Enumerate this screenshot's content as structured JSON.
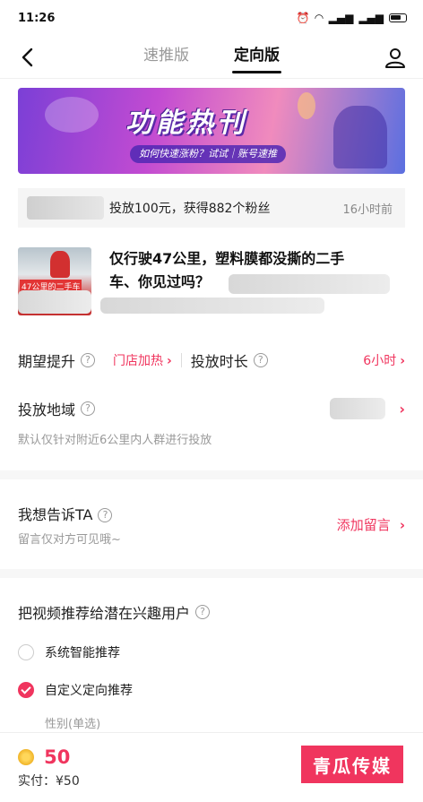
{
  "status": {
    "time": "11:26"
  },
  "nav": {
    "tabs": [
      {
        "label": "速推版"
      },
      {
        "label": "定向版"
      }
    ]
  },
  "banner": {
    "title": "功能热刊",
    "subtitle": "如何快速涨粉？试试｜账号速推"
  },
  "notice": {
    "text": "投放100元，获得882个粉丝",
    "time": "16小时前"
  },
  "video": {
    "title_line1": "仅行驶47公里，塑料膜都没撕的二手",
    "title_line2": "车、你见过吗？",
    "thumb_label": "47公里的二手车"
  },
  "options": {
    "expect_label": "期望提升",
    "expect_value": "门店加热",
    "duration_label": "投放时长",
    "duration_value": "6小时",
    "region_label": "投放地域",
    "region_desc": "默认仅针对附近6公里内人群进行投放"
  },
  "message": {
    "label": "我想告诉TA",
    "desc": "留言仅对方可见哦~",
    "action": "添加留言"
  },
  "target": {
    "title": "把视频推荐给潜在兴趣用户",
    "option1": "系统智能推荐",
    "option2": "自定义定向推荐",
    "gender_label": "性别(单选)"
  },
  "footer": {
    "price": "50",
    "actual": "实付：¥50",
    "button": "青瓜传媒"
  },
  "colors": {
    "accent": "#f0355e"
  }
}
